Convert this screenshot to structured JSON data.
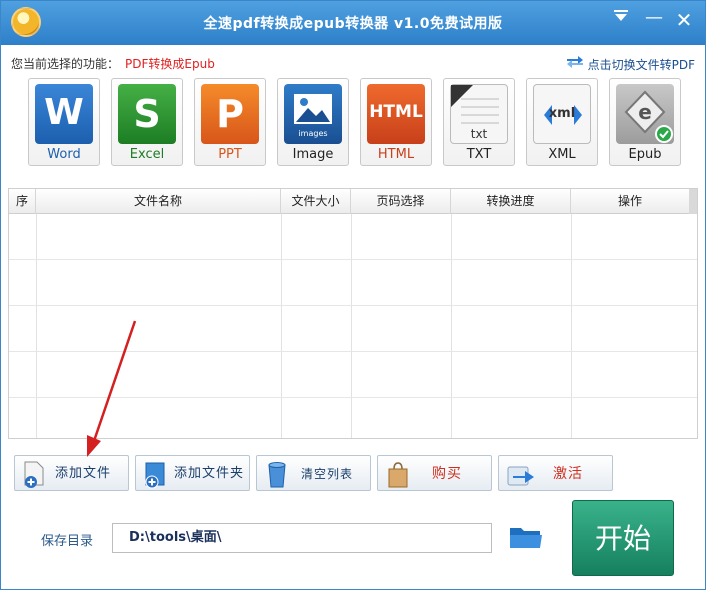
{
  "window": {
    "title": "全速pdf转换成epub转换器 v1.0免费试用版",
    "menu_icon": "dropdown-menu-icon",
    "minimize_glyph": "—",
    "close_glyph": "✕"
  },
  "function": {
    "label": "您当前选择的功能：",
    "current": "PDF转换成Epub",
    "switch_label": "点击切换文件转PDF"
  },
  "formats": [
    {
      "label": "Word",
      "glyph": "W"
    },
    {
      "label": "Excel",
      "glyph": "S"
    },
    {
      "label": "PPT",
      "glyph": "P"
    },
    {
      "label": "Image",
      "glyph": "images"
    },
    {
      "label": "HTML",
      "glyph": "HTML"
    },
    {
      "label": "TXT",
      "glyph": "txt"
    },
    {
      "label": "XML",
      "glyph": "xml"
    },
    {
      "label": "Epub",
      "glyph": "e"
    }
  ],
  "table": {
    "columns": [
      "序",
      "文件名称",
      "文件大小",
      "页码选择",
      "转换进度",
      "操作"
    ],
    "rows": []
  },
  "buttons": {
    "add_file": "添加文件",
    "add_folder": "添加文件夹",
    "clear_list": "清空列表",
    "buy": "购买",
    "activate": "激活",
    "start": "开始"
  },
  "save": {
    "label": "保存目录",
    "path": "D:\\tools\\桌面\\"
  },
  "colors": {
    "titlebar": "#2d7fc9",
    "accent_red": "#e02020",
    "start_green": "#16805f",
    "annotation_arrow": "#d42020"
  }
}
